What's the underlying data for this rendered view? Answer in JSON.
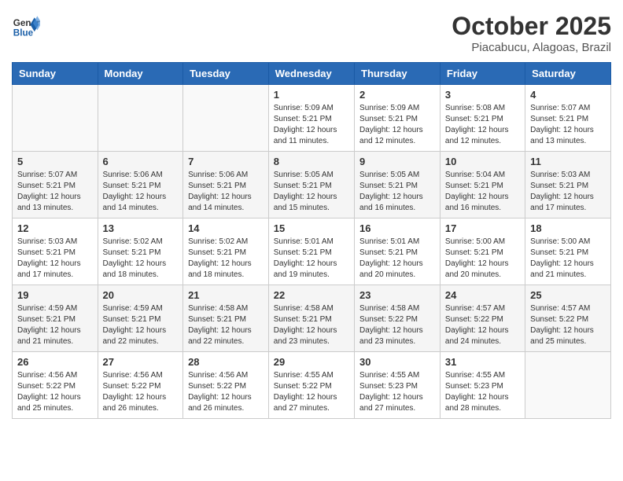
{
  "header": {
    "logo_general": "General",
    "logo_blue": "Blue",
    "month": "October 2025",
    "location": "Piacabucu, Alagoas, Brazil"
  },
  "weekdays": [
    "Sunday",
    "Monday",
    "Tuesday",
    "Wednesday",
    "Thursday",
    "Friday",
    "Saturday"
  ],
  "weeks": [
    [
      {
        "day": "",
        "info": ""
      },
      {
        "day": "",
        "info": ""
      },
      {
        "day": "",
        "info": ""
      },
      {
        "day": "1",
        "info": "Sunrise: 5:09 AM\nSunset: 5:21 PM\nDaylight: 12 hours\nand 11 minutes."
      },
      {
        "day": "2",
        "info": "Sunrise: 5:09 AM\nSunset: 5:21 PM\nDaylight: 12 hours\nand 12 minutes."
      },
      {
        "day": "3",
        "info": "Sunrise: 5:08 AM\nSunset: 5:21 PM\nDaylight: 12 hours\nand 12 minutes."
      },
      {
        "day": "4",
        "info": "Sunrise: 5:07 AM\nSunset: 5:21 PM\nDaylight: 12 hours\nand 13 minutes."
      }
    ],
    [
      {
        "day": "5",
        "info": "Sunrise: 5:07 AM\nSunset: 5:21 PM\nDaylight: 12 hours\nand 13 minutes."
      },
      {
        "day": "6",
        "info": "Sunrise: 5:06 AM\nSunset: 5:21 PM\nDaylight: 12 hours\nand 14 minutes."
      },
      {
        "day": "7",
        "info": "Sunrise: 5:06 AM\nSunset: 5:21 PM\nDaylight: 12 hours\nand 14 minutes."
      },
      {
        "day": "8",
        "info": "Sunrise: 5:05 AM\nSunset: 5:21 PM\nDaylight: 12 hours\nand 15 minutes."
      },
      {
        "day": "9",
        "info": "Sunrise: 5:05 AM\nSunset: 5:21 PM\nDaylight: 12 hours\nand 16 minutes."
      },
      {
        "day": "10",
        "info": "Sunrise: 5:04 AM\nSunset: 5:21 PM\nDaylight: 12 hours\nand 16 minutes."
      },
      {
        "day": "11",
        "info": "Sunrise: 5:03 AM\nSunset: 5:21 PM\nDaylight: 12 hours\nand 17 minutes."
      }
    ],
    [
      {
        "day": "12",
        "info": "Sunrise: 5:03 AM\nSunset: 5:21 PM\nDaylight: 12 hours\nand 17 minutes."
      },
      {
        "day": "13",
        "info": "Sunrise: 5:02 AM\nSunset: 5:21 PM\nDaylight: 12 hours\nand 18 minutes."
      },
      {
        "day": "14",
        "info": "Sunrise: 5:02 AM\nSunset: 5:21 PM\nDaylight: 12 hours\nand 18 minutes."
      },
      {
        "day": "15",
        "info": "Sunrise: 5:01 AM\nSunset: 5:21 PM\nDaylight: 12 hours\nand 19 minutes."
      },
      {
        "day": "16",
        "info": "Sunrise: 5:01 AM\nSunset: 5:21 PM\nDaylight: 12 hours\nand 20 minutes."
      },
      {
        "day": "17",
        "info": "Sunrise: 5:00 AM\nSunset: 5:21 PM\nDaylight: 12 hours\nand 20 minutes."
      },
      {
        "day": "18",
        "info": "Sunrise: 5:00 AM\nSunset: 5:21 PM\nDaylight: 12 hours\nand 21 minutes."
      }
    ],
    [
      {
        "day": "19",
        "info": "Sunrise: 4:59 AM\nSunset: 5:21 PM\nDaylight: 12 hours\nand 21 minutes."
      },
      {
        "day": "20",
        "info": "Sunrise: 4:59 AM\nSunset: 5:21 PM\nDaylight: 12 hours\nand 22 minutes."
      },
      {
        "day": "21",
        "info": "Sunrise: 4:58 AM\nSunset: 5:21 PM\nDaylight: 12 hours\nand 22 minutes."
      },
      {
        "day": "22",
        "info": "Sunrise: 4:58 AM\nSunset: 5:21 PM\nDaylight: 12 hours\nand 23 minutes."
      },
      {
        "day": "23",
        "info": "Sunrise: 4:58 AM\nSunset: 5:22 PM\nDaylight: 12 hours\nand 23 minutes."
      },
      {
        "day": "24",
        "info": "Sunrise: 4:57 AM\nSunset: 5:22 PM\nDaylight: 12 hours\nand 24 minutes."
      },
      {
        "day": "25",
        "info": "Sunrise: 4:57 AM\nSunset: 5:22 PM\nDaylight: 12 hours\nand 25 minutes."
      }
    ],
    [
      {
        "day": "26",
        "info": "Sunrise: 4:56 AM\nSunset: 5:22 PM\nDaylight: 12 hours\nand 25 minutes."
      },
      {
        "day": "27",
        "info": "Sunrise: 4:56 AM\nSunset: 5:22 PM\nDaylight: 12 hours\nand 26 minutes."
      },
      {
        "day": "28",
        "info": "Sunrise: 4:56 AM\nSunset: 5:22 PM\nDaylight: 12 hours\nand 26 minutes."
      },
      {
        "day": "29",
        "info": "Sunrise: 4:55 AM\nSunset: 5:22 PM\nDaylight: 12 hours\nand 27 minutes."
      },
      {
        "day": "30",
        "info": "Sunrise: 4:55 AM\nSunset: 5:23 PM\nDaylight: 12 hours\nand 27 minutes."
      },
      {
        "day": "31",
        "info": "Sunrise: 4:55 AM\nSunset: 5:23 PM\nDaylight: 12 hours\nand 28 minutes."
      },
      {
        "day": "",
        "info": ""
      }
    ]
  ]
}
